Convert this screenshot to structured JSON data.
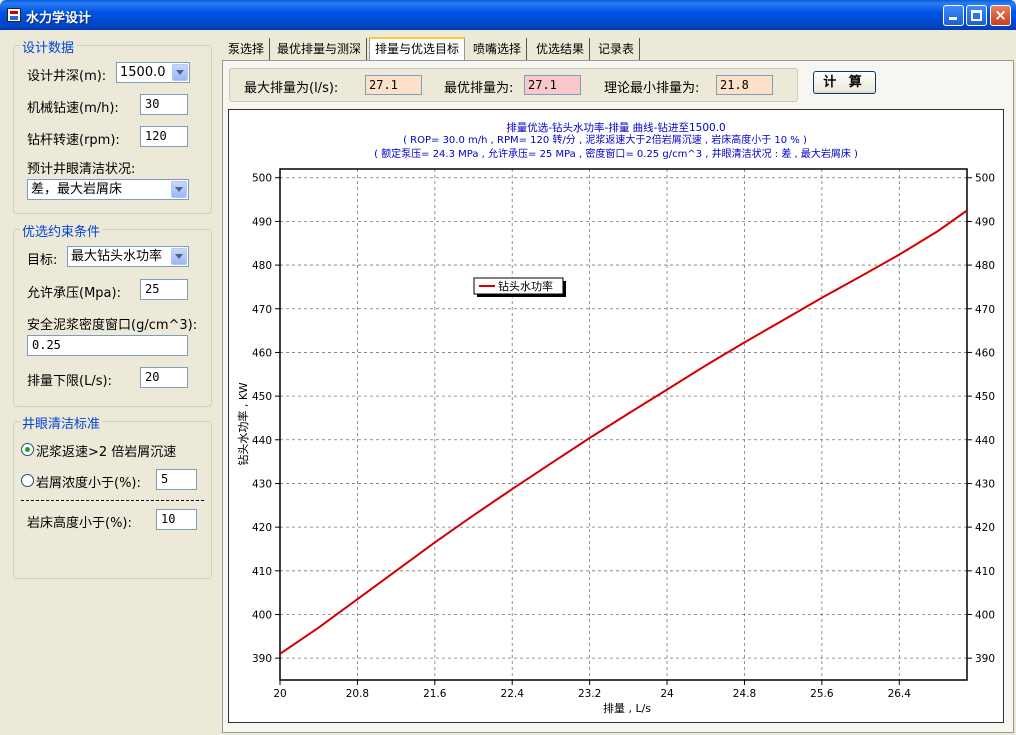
{
  "window": {
    "title": "水力学设计",
    "buttons": {
      "minimize": "minimize",
      "maximize": "maximize",
      "close": "×"
    }
  },
  "design_data": {
    "legend": "设计数据",
    "depth_label": "设计井深(m):",
    "depth_value": "1500.0",
    "rop_label": "机械钻速(m/h):",
    "rop_value": "30",
    "rpm_label": "钻杆转速(rpm):",
    "rpm_value": "120",
    "clean_label": "预计井眼清洁状况:",
    "clean_value": "差，最大岩屑床"
  },
  "constraints": {
    "legend": "优选约束条件",
    "target_label": "目标:",
    "target_value": "最大钻头水功率",
    "pressure_label": "允许承压(Mpa):",
    "pressure_value": "25",
    "density_label": "安全泥浆密度窗口(g/cm^3):",
    "density_value": "0.25",
    "flow_min_label": "排量下限(L/s):",
    "flow_min_value": "20"
  },
  "cleaning": {
    "legend": "井眼清洁标准",
    "opt1_label": "泥浆返速>2 倍岩屑沉速",
    "opt1_selected": true,
    "opt2_label": "岩屑浓度小于(%):",
    "opt2_value": "5",
    "bed_label": "岩床高度小于(%):",
    "bed_value": "10"
  },
  "tabs": [
    {
      "label": "泵选择"
    },
    {
      "label": "最优排量与测深"
    },
    {
      "label": "排量与优选目标",
      "active": true
    },
    {
      "label": "喷嘴选择"
    },
    {
      "label": "优选结果"
    },
    {
      "label": "记录表"
    }
  ],
  "results": {
    "max_flow_label": "最大排量为(l/s):",
    "max_flow_value": "27.1",
    "opt_flow_label": "最优排量为:",
    "opt_flow_value": "27.1",
    "min_flow_label": "理论最小排量为:",
    "min_flow_value": "21.8",
    "calc_button": "计 算"
  },
  "colors": {
    "series": "#d40000",
    "title_text": "#0000cc",
    "max_flow_bg": "#fde0c8",
    "opt_flow_bg": "#f8c8cc",
    "min_flow_bg": "#fde0c8"
  },
  "chart_data": {
    "type": "line",
    "title": "排量优选-钻头水功率-排量 曲线-钻进至1500.0",
    "subtitle_1": "( ROP= 30.0 m/h , RPM= 120 转/分 , 泥浆返速大于2倍岩屑沉速 , 岩床高度小于 10 % )",
    "subtitle_2": "( 额定泵压= 24.3 MPa , 允许承压= 25 MPa , 密度窗口= 0.25 g/cm^3 , 井眼清洁状况 : 差 , 最大岩屑床 )",
    "xlabel": "排量 , L/s",
    "ylabel": "钻头水功率 , KW",
    "xlim": [
      20,
      27.1
    ],
    "ylim": [
      385,
      502
    ],
    "xticks": [
      20,
      20.8,
      21.6,
      22.4,
      23.2,
      24,
      24.8,
      25.6,
      26.4
    ],
    "yticks": [
      390,
      400,
      410,
      420,
      430,
      440,
      450,
      460,
      470,
      480,
      490,
      500
    ],
    "grid": true,
    "legend_position": "upper-left",
    "series": [
      {
        "name": "钻头水功率",
        "x": [
          20,
          20.4,
          20.8,
          21.2,
          21.6,
          22.0,
          22.4,
          22.8,
          23.2,
          23.6,
          24.0,
          24.4,
          24.8,
          25.2,
          25.6,
          26.0,
          26.4,
          26.8,
          27.1
        ],
        "y": [
          391,
          397,
          403.5,
          410,
          416.5,
          422.7,
          428.7,
          434.6,
          440.4,
          446,
          451.5,
          457,
          462.3,
          467.4,
          472.5,
          477.4,
          482.4,
          487.8,
          492.5
        ]
      }
    ]
  }
}
